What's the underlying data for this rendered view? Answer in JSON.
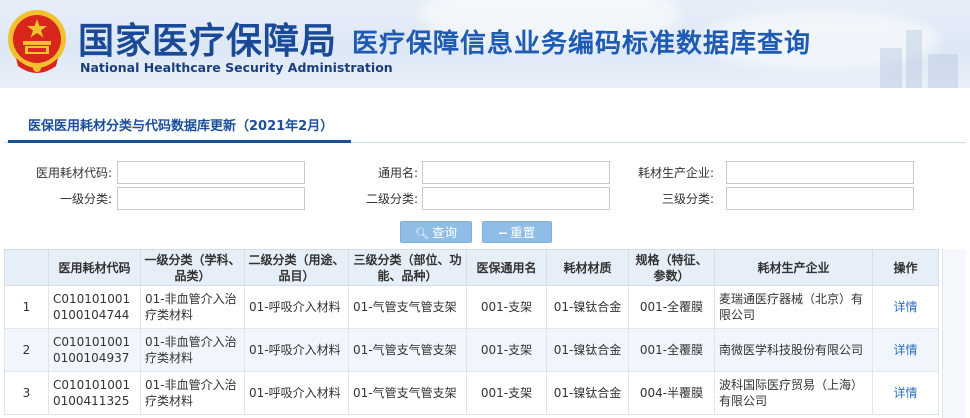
{
  "header": {
    "org_name_cn": "国家医疗保障局",
    "org_name_en": "National Healthcare Security Administration",
    "system_title": "医疗保障信息业务编码标准数据库查询"
  },
  "tab": {
    "active_label": "医保医用耗材分类与代码数据库更新（2021年2月）"
  },
  "form": {
    "row1": [
      {
        "label": "医用耗材代码:",
        "value": ""
      },
      {
        "label": "通用名:",
        "value": ""
      },
      {
        "label": "耗材生产企业:",
        "value": ""
      }
    ],
    "row2": [
      {
        "label": "一级分类:",
        "value": ""
      },
      {
        "label": "二级分类:",
        "value": ""
      },
      {
        "label": "三级分类:",
        "value": ""
      }
    ]
  },
  "buttons": {
    "search": "查询",
    "reset": "重置"
  },
  "table": {
    "headers": [
      "",
      "医用耗材代码",
      "一级分类（学科、品类）",
      "二级分类（用途、品目）",
      "三级分类（部位、功能、品种）",
      "医保通用名",
      "耗材材质",
      "规格（特征、参数）",
      "耗材生产企业",
      "操作"
    ],
    "rows": [
      {
        "no": "1",
        "code": "C0101010010100104744",
        "cat1": "01-非血管介入治疗类材料",
        "cat2": "01-呼吸介入材料",
        "cat3": "01-气管支气管支架",
        "generic": "001-支架",
        "material": "01-镍钛合金",
        "spec": "001-全覆膜",
        "maker": "麦瑞通医疗器械（北京）有限公司",
        "action": "详情"
      },
      {
        "no": "2",
        "code": "C0101010010100104937",
        "cat1": "01-非血管介入治疗类材料",
        "cat2": "01-呼吸介入材料",
        "cat3": "01-气管支气管支架",
        "generic": "001-支架",
        "material": "01-镍钛合金",
        "spec": "001-全覆膜",
        "maker": "南微医学科技股份有限公司",
        "action": "详情"
      },
      {
        "no": "3",
        "code": "C0101010010100411325",
        "cat1": "01-非血管介入治疗类材料",
        "cat2": "01-呼吸介入材料",
        "cat3": "01-气管支气管支架",
        "generic": "001-支架",
        "material": "01-镍钛合金",
        "spec": "004-半覆膜",
        "maker": "波科国际医疗贸易（上海）有限公司",
        "action": "详情"
      }
    ]
  },
  "colors": {
    "brand_blue": "#1a4a97",
    "button_blue": "#8fbde6",
    "link_blue": "#2a6fc4",
    "emblem_red": "#d8261c",
    "emblem_gold": "#f2c12e"
  },
  "icons": {
    "search": "search-icon",
    "reset": "minus-icon",
    "emblem": "national-emblem-icon"
  }
}
